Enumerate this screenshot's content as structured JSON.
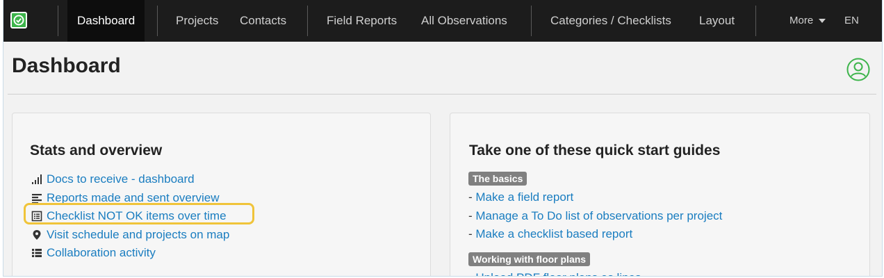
{
  "navbar": {
    "items": [
      {
        "label": "Dashboard",
        "active": true
      },
      {
        "label": "Projects"
      },
      {
        "label": "Contacts"
      },
      {
        "label": "Field Reports"
      },
      {
        "label": "All Observations"
      },
      {
        "label": "Categories / Checklists"
      },
      {
        "label": "Layout"
      }
    ],
    "more_label": "More",
    "lang_label": "EN"
  },
  "header": {
    "title": "Dashboard"
  },
  "stats": {
    "title": "Stats and overview",
    "links": [
      {
        "label": "Docs to receive - dashboard",
        "icon": "signal-bars-icon"
      },
      {
        "label": "Reports made and sent overview",
        "icon": "align-left-icon"
      },
      {
        "label": "Checklist NOT OK items over time",
        "icon": "list-alt-icon"
      },
      {
        "label": "Visit schedule and projects on map",
        "icon": "map-marker-icon"
      },
      {
        "label": "Collaboration activity",
        "icon": "list-icon"
      }
    ]
  },
  "guides": {
    "title": "Take one of these quick start guides",
    "sections": [
      {
        "badge": "The basics",
        "links": [
          "Make a field report",
          "Manage a To Do list of observations per project",
          "Make a checklist based report"
        ]
      },
      {
        "badge": "Working with floor plans",
        "links": [
          "Upload PDF floor plans as lines"
        ]
      }
    ],
    "bullet": "- "
  },
  "colors": {
    "navbar_bg": "#1c1c1c",
    "link": "#1a7dc0",
    "brand_green": "#3cb44a",
    "highlight": "#f0c43a",
    "badge_bg": "#808080"
  }
}
